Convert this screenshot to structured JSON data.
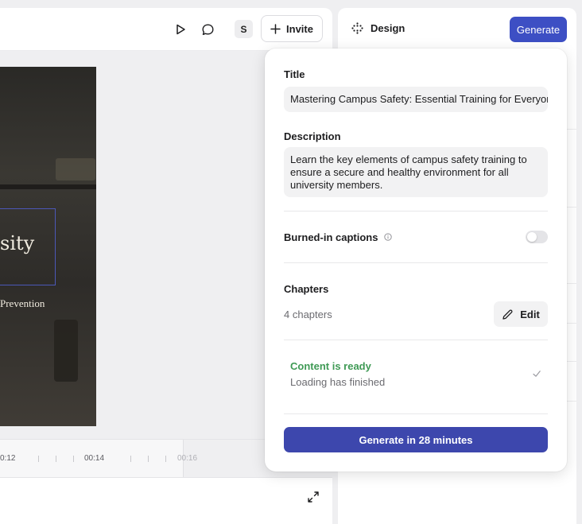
{
  "toolbar": {
    "avatar_initial": "S",
    "invite_label": "Invite",
    "play_icon": "play-icon",
    "comment_icon": "comment-icon"
  },
  "slide": {
    "headline": "sity",
    "subheadline": "Prevention"
  },
  "timeline": {
    "times": [
      "0:12",
      "00:14",
      "00:16"
    ]
  },
  "design_panel": {
    "tab_label": "Design",
    "generate_label": "Generate",
    "accent_color": "#3d4fc4"
  },
  "popover": {
    "title_label": "Title",
    "title_value": "Mastering Campus Safety: Essential Training for Everyone",
    "description_label": "Description",
    "description_value": "Learn the key elements of campus safety training to ensure a secure and healthy environment for all university members.",
    "captions_label": "Burned-in captions",
    "captions_enabled": false,
    "chapters_label": "Chapters",
    "chapters_count": "4 chapters",
    "edit_label": "Edit",
    "status_title": "Content is ready",
    "status_subtitle": "Loading has finished",
    "status_color": "#3f9a55",
    "primary_label": "Generate in 28 minutes",
    "primary_color": "#3d47ad"
  }
}
